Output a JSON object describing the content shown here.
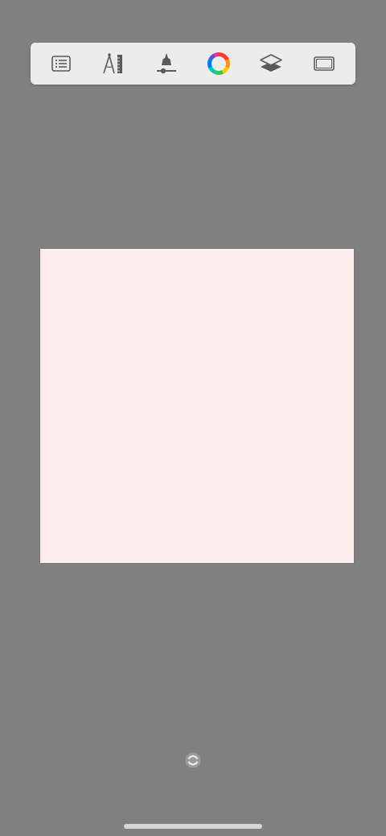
{
  "toolbar": {
    "items": [
      {
        "name": "menu-list",
        "icon": "list-icon"
      },
      {
        "name": "guides",
        "icon": "compass-ruler-icon"
      },
      {
        "name": "brush",
        "icon": "brush-icon"
      },
      {
        "name": "color",
        "icon": "color-wheel-icon"
      },
      {
        "name": "layers",
        "icon": "layers-icon"
      },
      {
        "name": "canvas-frame",
        "icon": "frame-icon"
      }
    ]
  },
  "canvas": {
    "background_color": "#fcecec"
  },
  "colors": {
    "workspace": "#808080",
    "toolbar": "#ececec",
    "icon": "#5a5a5a"
  },
  "bottom": {
    "sync_icon": "sync-icon"
  }
}
